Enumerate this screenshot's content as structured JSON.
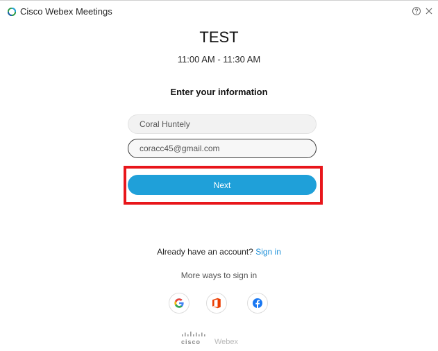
{
  "app": {
    "title": "Cisco Webex Meetings"
  },
  "meeting": {
    "title": "TEST",
    "time": "11:00 AM - 11:30 AM"
  },
  "form": {
    "heading": "Enter your information",
    "name_value": "Coral Huntely",
    "email_value": "coracc45@gmail.com",
    "next_label": "Next"
  },
  "signin": {
    "prompt": "Already have an account?",
    "link_label": "Sign in",
    "more_ways": "More ways to sign in",
    "providers": [
      {
        "name": "google",
        "icon": "google-icon"
      },
      {
        "name": "office",
        "icon": "office-icon"
      },
      {
        "name": "facebook",
        "icon": "facebook-icon"
      }
    ]
  },
  "footer": {
    "cisco": "cisco",
    "product": "Webex"
  },
  "colors": {
    "accent": "#1fa0d9",
    "link": "#1c8fd8",
    "highlight": "#e8161b",
    "office": "#eb3c00",
    "facebook": "#1877f2"
  }
}
